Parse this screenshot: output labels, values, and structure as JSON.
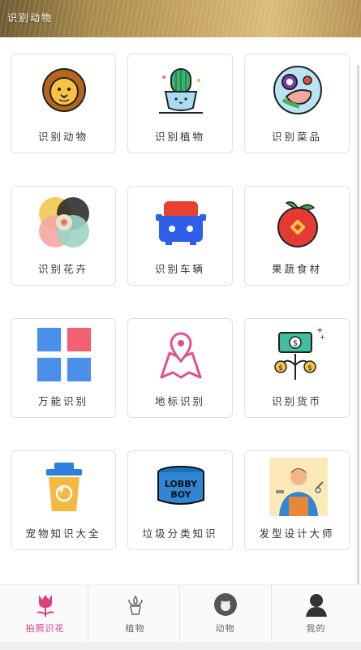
{
  "header": {
    "title": "识别动物"
  },
  "cards": [
    {
      "label": "识别动物",
      "icon": "lion-icon"
    },
    {
      "label": "识别植物",
      "icon": "cactus-icon"
    },
    {
      "label": "识别菜品",
      "icon": "dish-icon"
    },
    {
      "label": "识别花卉",
      "icon": "flower-pattern-icon"
    },
    {
      "label": "识别车辆",
      "icon": "car-icon"
    },
    {
      "label": "果蔬食材",
      "icon": "apple-icon"
    },
    {
      "label": "万能识别",
      "icon": "grid-icon"
    },
    {
      "label": "地标识别",
      "icon": "map-pin-icon"
    },
    {
      "label": "识别货币",
      "icon": "money-icon"
    },
    {
      "label": "宠物知识大全",
      "icon": "trash-bin-icon"
    },
    {
      "label": "垃圾分类知识",
      "icon": "lobby-boy-icon"
    },
    {
      "label": "发型设计大师",
      "icon": "barber-icon"
    }
  ],
  "tabs": [
    {
      "label": "拍照识花",
      "icon": "tulip-icon",
      "active": true
    },
    {
      "label": "植物",
      "icon": "plant-icon",
      "active": false
    },
    {
      "label": "动物",
      "icon": "monkey-icon",
      "active": false
    },
    {
      "label": "我的",
      "icon": "user-icon",
      "active": false
    }
  ],
  "colors": {
    "active": "#e0407a",
    "text": "#333333",
    "border": "#e1e1e1"
  }
}
